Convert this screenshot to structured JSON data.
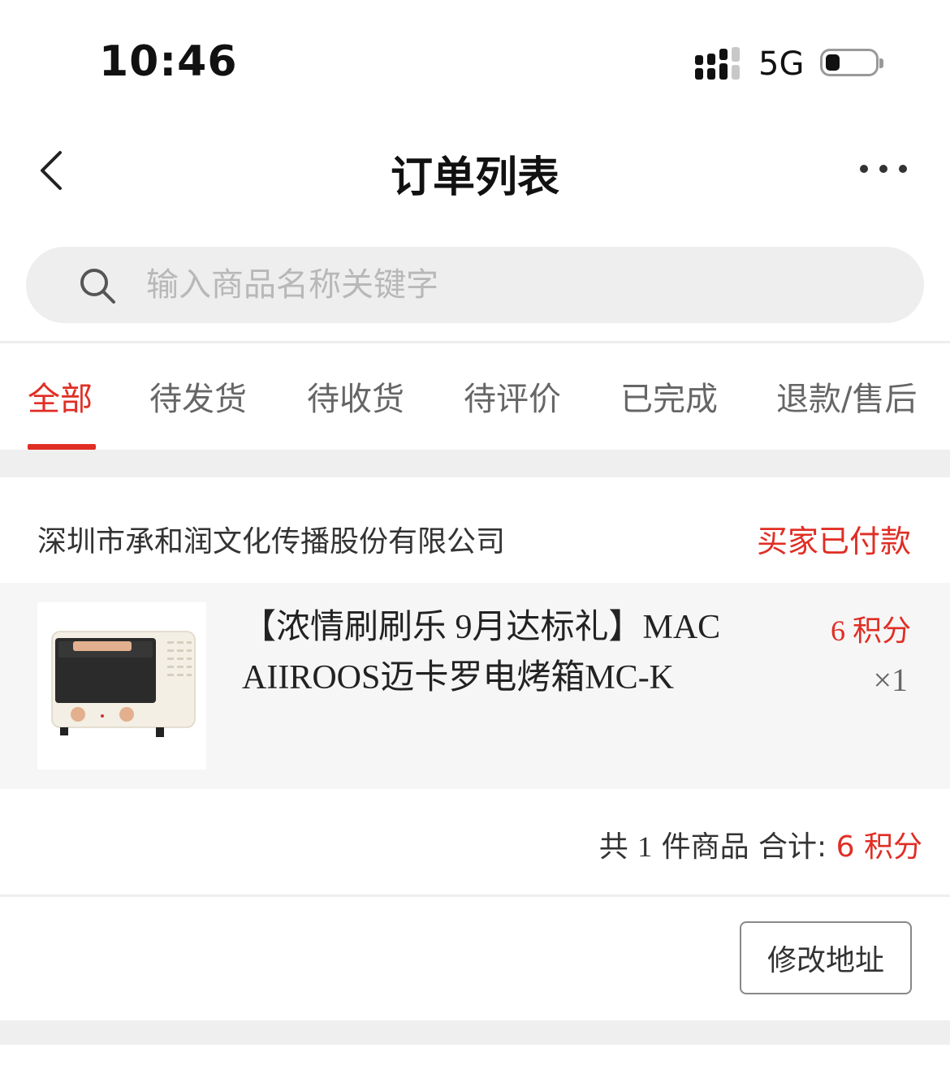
{
  "status_bar": {
    "time": "10:46",
    "network": "5G",
    "battery_level": 0.3,
    "signal_icon": "signal-bars-icon"
  },
  "nav": {
    "title": "订单列表",
    "back_icon": "chevron-left-icon",
    "more_icon": "more-dots-icon"
  },
  "search": {
    "placeholder": "输入商品名称关键字",
    "value": "",
    "icon": "search-icon"
  },
  "tabs": [
    {
      "label": "全部",
      "active": true
    },
    {
      "label": "待发货",
      "active": false
    },
    {
      "label": "待收货",
      "active": false
    },
    {
      "label": "待评价",
      "active": false
    },
    {
      "label": "已完成",
      "active": false
    },
    {
      "label": "退款/售后",
      "active": false
    }
  ],
  "orders": [
    {
      "shop_name": "深圳市承和润文化传播股份有限公司",
      "status": "买家已付款",
      "item": {
        "title": "【浓情刷刷乐 9月达标礼】MACAIIROOS迈卡罗电烤箱MC-K",
        "price": "6 积分",
        "quantity": "×1",
        "thumbnail_icon": "toaster-oven-image"
      },
      "summary": {
        "prefix": "共",
        "count": "1",
        "count_suffix": "件商品 合计:",
        "total": "6 积分"
      },
      "action_label": "修改地址"
    }
  ],
  "colors": {
    "accent": "#e02e24",
    "background_gap": "#efefef",
    "item_bg": "#f6f6f6"
  }
}
